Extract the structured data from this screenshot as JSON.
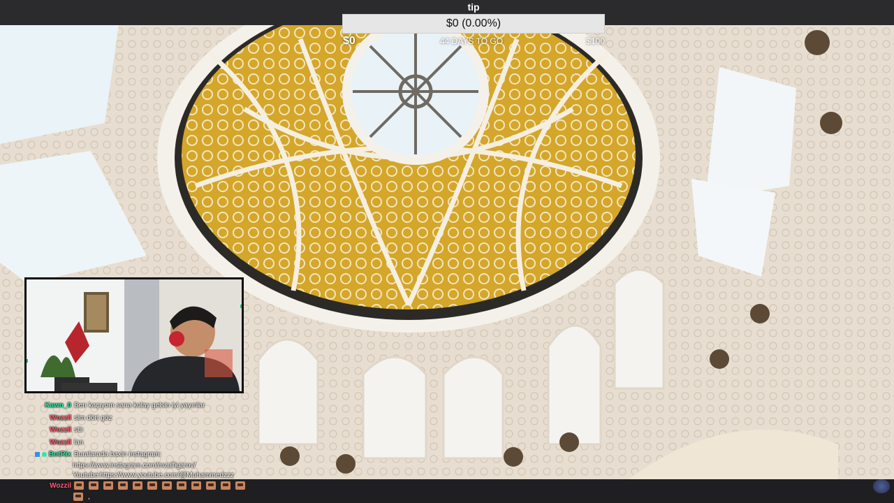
{
  "goal": {
    "title": "tip",
    "amount_text": "$0 (0.00%)",
    "progress_fraction": 0,
    "min_label": "$0",
    "days_label": "44 DAYS TO GO",
    "max_label": "$100"
  },
  "chat": {
    "messages": [
      {
        "user": "Kawn_0",
        "color": "#2ee8a8",
        "text": "Ben kaçıyom sana kolay gelsin iyi yayınlar"
      },
      {
        "user": "Wozzil",
        "color": "#ff5a6e",
        "text": "slm dört göz"
      },
      {
        "user": "Wozzil",
        "color": "#ff5a6e",
        "text": "stir"
      },
      {
        "user": "Wozzil",
        "color": "#ff5a6e",
        "text": "lan"
      },
      {
        "user": "BotRix",
        "color": "#2ee8a8",
        "text": "Buralarada baxin instagram:",
        "bot": true
      }
    ],
    "bot_continuation": [
      "https://www.instagram.com/mzulfigarov/",
      "Youtube:https://www.youtube.com/@Muhammedzzz"
    ],
    "emote_message": {
      "user": "Wozzil",
      "color": "#ff5a6e",
      "emote_count_row1": 12,
      "second_row_suffix": ","
    }
  },
  "colors": {
    "goal_fill": "#9147ff",
    "bar_background": "#2b2b2e",
    "webcam_accent": "#00d26a"
  },
  "icons": {
    "bot_badge": "bot-badge-icon",
    "verified_badge": "verified-badge-icon",
    "emote": "emote-icon",
    "corner_logo": "streamer-logo-icon"
  }
}
